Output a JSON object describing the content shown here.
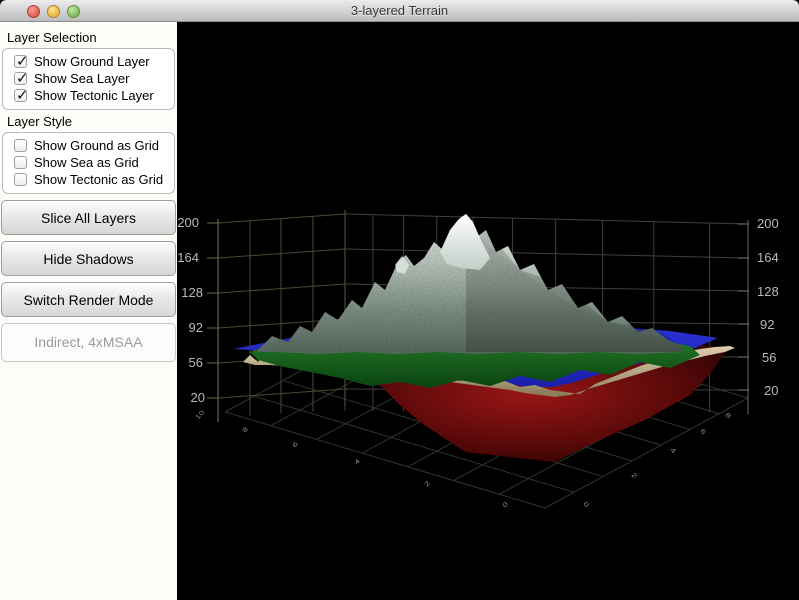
{
  "window": {
    "title": "3-layered Terrain",
    "controls": [
      "close",
      "minimize",
      "zoom"
    ]
  },
  "icons": {
    "check": "✓"
  },
  "sidebar": {
    "sections": [
      {
        "title": "Layer Selection",
        "items": [
          {
            "label": "Show Ground Layer",
            "checked": true
          },
          {
            "label": "Show Sea Layer",
            "checked": true
          },
          {
            "label": "Show Tectonic Layer",
            "checked": true
          }
        ]
      },
      {
        "title": "Layer Style",
        "items": [
          {
            "label": "Show Ground as Grid",
            "checked": false
          },
          {
            "label": "Show Sea as Grid",
            "checked": false
          },
          {
            "label": "Show Tectonic as Grid",
            "checked": false
          }
        ]
      }
    ],
    "buttons": [
      "Slice All Layers",
      "Hide Shadows",
      "Switch Render Mode"
    ],
    "render_mode_status": "Indirect, 4xMSAA"
  },
  "viewport": {
    "background": "#000000",
    "elevation_axis": {
      "left": [
        "200",
        "164",
        "128",
        "92",
        "56",
        "20"
      ],
      "right": [
        "200",
        "164",
        "128",
        "92",
        "56",
        "20"
      ]
    },
    "floor_axis": {
      "left": [
        "10",
        "8",
        "6",
        "4",
        "2",
        "0"
      ],
      "right": [
        "0",
        "2",
        "4",
        "6",
        "8"
      ]
    },
    "grid_colors": {
      "left_wall": "#4e4936",
      "right_wall": "#3f3f3f",
      "floor": "#2c362c",
      "axis_line_left": "#6b6349",
      "axis_line_right": "#565656",
      "axis_label": "#b9b9b9",
      "floor_label": "#8f8f8f"
    },
    "layer_colors": {
      "snow": "#f2f5f2",
      "rock": "#9aaba1",
      "ground_green": "#1f7c26",
      "sea": "#2a2fd6",
      "ground_edge_tan": "#cbbc9b",
      "tectonic_red": "#8e1212"
    }
  }
}
